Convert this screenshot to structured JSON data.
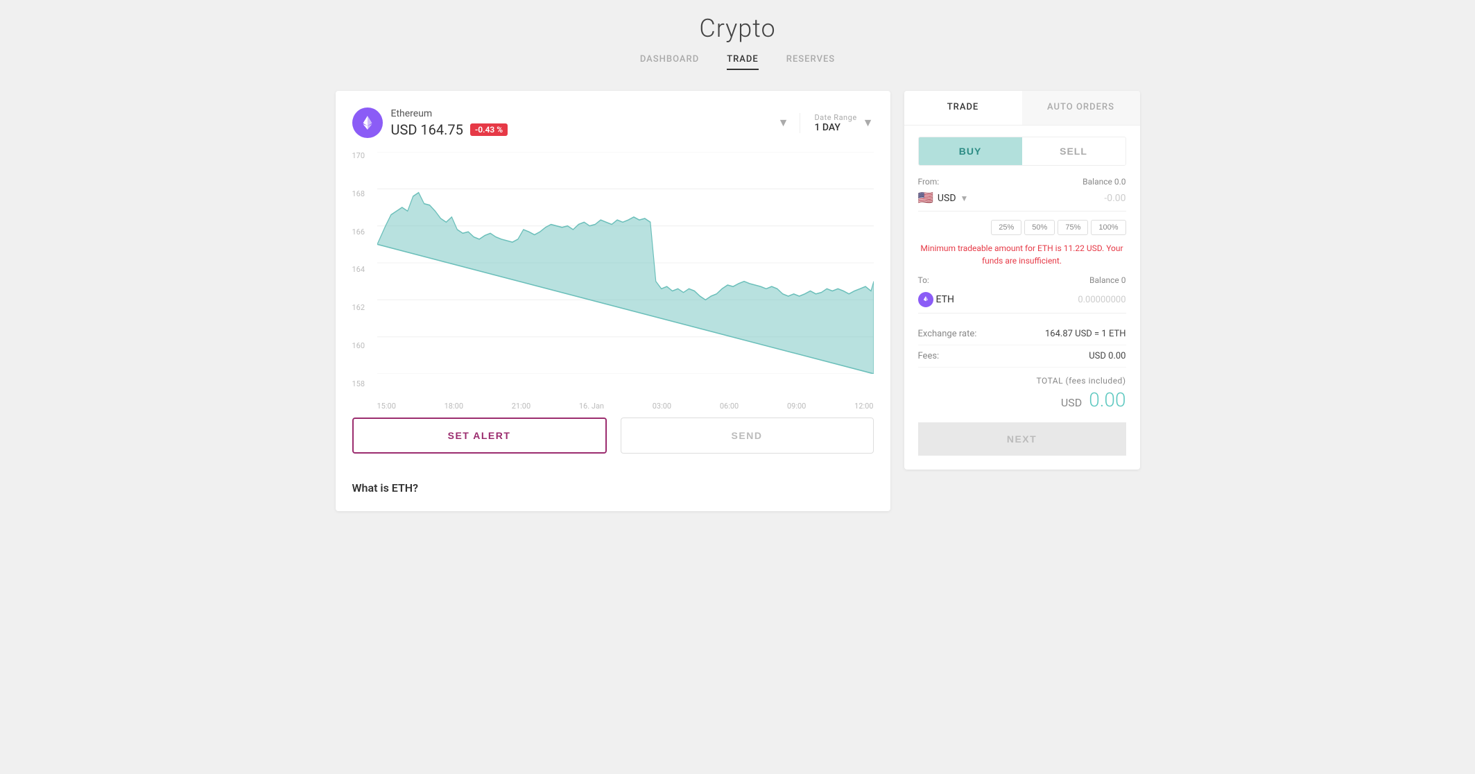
{
  "page": {
    "title": "Crypto"
  },
  "nav": {
    "tabs": [
      {
        "id": "dashboard",
        "label": "DASHBOARD",
        "active": false
      },
      {
        "id": "trade",
        "label": "TRADE",
        "active": true
      },
      {
        "id": "reserves",
        "label": "RESERVES",
        "active": false
      }
    ]
  },
  "chart_panel": {
    "asset_name": "Ethereum",
    "asset_price": "USD 164.75",
    "price_change": "-0.43 %",
    "date_range_label": "Date Range",
    "date_range_value": "1 DAY",
    "y_labels": [
      "170",
      "168",
      "166",
      "164",
      "162",
      "160",
      "158"
    ],
    "x_labels": [
      "15:00",
      "18:00",
      "21:00",
      "16. Jan",
      "03:00",
      "06:00",
      "09:00",
      "12:00"
    ],
    "btn_set_alert": "SET ALERT",
    "btn_send": "SEND"
  },
  "what_is_section": {
    "title": "What is ETH?"
  },
  "right_panel": {
    "tabs": [
      {
        "id": "trade",
        "label": "TRADE",
        "active": true
      },
      {
        "id": "auto_orders",
        "label": "AUTO ORDERS",
        "active": false
      }
    ],
    "buy_label": "BUY",
    "sell_label": "SELL",
    "from_label": "From:",
    "from_balance_label": "Balance 0.0",
    "from_currency": "USD",
    "from_amount": "-0.00",
    "pct_buttons": [
      "25%",
      "50%",
      "75%",
      "100%"
    ],
    "error_message": "Minimum tradeable amount for ETH is 11.22 USD. Your funds are insufficient.",
    "to_label": "To:",
    "to_balance_label": "Balance 0",
    "to_currency": "ETH",
    "to_amount": "0.00000000",
    "exchange_rate_label": "Exchange rate:",
    "exchange_rate_value": "164.87 USD = 1 ETH",
    "fees_label": "Fees:",
    "fees_value": "USD 0.00",
    "total_label": "TOTAL (fees included)",
    "total_currency": "USD",
    "total_amount": "0.00",
    "next_btn": "NEXT"
  }
}
